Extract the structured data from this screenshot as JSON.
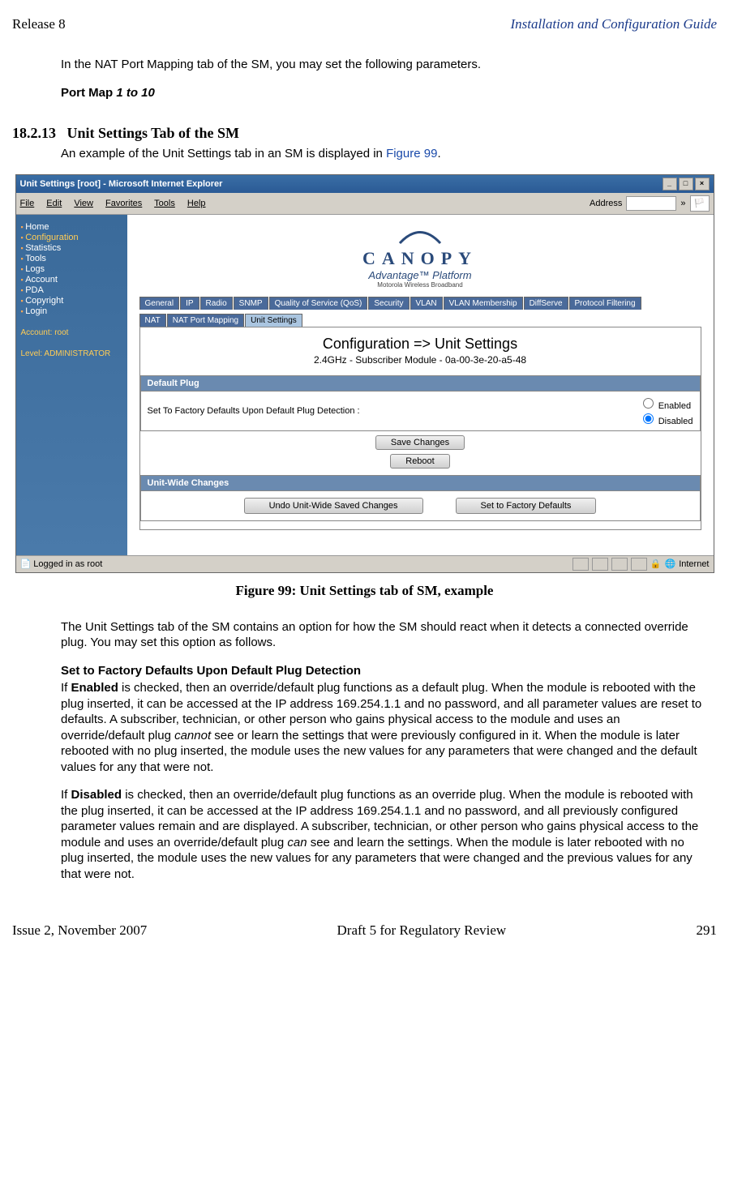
{
  "header": {
    "left": "Release 8",
    "right": "Installation and Configuration Guide"
  },
  "intro": {
    "p1": "In the NAT Port Mapping tab of the SM, you may set the following parameters.",
    "portmap_label": "Port Map ",
    "portmap_range": "1 to 10"
  },
  "section": {
    "number": "18.2.13",
    "title": "Unit Settings Tab of the SM",
    "lead": "An example of the Unit Settings tab in an SM is displayed in ",
    "figref": "Figure 99",
    "period": "."
  },
  "screenshot": {
    "window_title": "Unit Settings [root] - Microsoft Internet Explorer",
    "menubar": [
      "File",
      "Edit",
      "View",
      "Favorites",
      "Tools",
      "Help"
    ],
    "address_label": "Address",
    "sidebar": {
      "items": [
        "Home",
        "Configuration",
        "Statistics",
        "Tools",
        "Logs",
        "Account",
        "PDA",
        "Copyright",
        "Login"
      ],
      "account": "Account: root",
      "level": "Level: ADMINISTRATOR"
    },
    "logo": {
      "name": "CANOPY",
      "sub": "Advantage™ Platform",
      "tag": "Motorola Wireless Broadband"
    },
    "tabs_row1": [
      "General",
      "IP",
      "Radio",
      "SNMP",
      "Quality of Service (QoS)",
      "Security",
      "VLAN",
      "VLAN Membership",
      "DiffServe",
      "Protocol Filtering"
    ],
    "tabs_row2": [
      "NAT",
      "NAT Port Mapping",
      "Unit Settings"
    ],
    "conf_title": "Configuration => Unit Settings",
    "conf_sub": "2.4GHz - Subscriber Module - 0a-00-3e-20-a5-48",
    "panel1_header": "Default Plug",
    "panel1_label": "Set To Factory Defaults Upon Default Plug Detection :",
    "radio_enabled": "Enabled",
    "radio_disabled": "Disabled",
    "btn_save": "Save Changes",
    "btn_reboot": "Reboot",
    "panel2_header": "Unit-Wide Changes",
    "btn_undo": "Undo Unit-Wide Saved Changes",
    "btn_factory": "Set to Factory Defaults",
    "status_left": "Logged in as root",
    "status_right": "Internet"
  },
  "caption": "Figure 99: Unit Settings tab of SM, example",
  "after": {
    "p1": "The Unit Settings tab of the SM contains an option for how the SM should react when it detects a connected override plug. You may set this option as follows.",
    "h1": "Set to Factory Defaults Upon Default Plug Detection",
    "p2a": "If ",
    "p2b": "Enabled",
    "p2c": " is checked, then an override/default plug functions as a default plug. When the module is rebooted with the plug inserted, it can be accessed at the IP address 169.254.1.1 and no password, and all parameter values are reset to defaults. A subscriber, technician, or other person who gains physical access to the module and uses an override/default plug ",
    "p2d": "cannot",
    "p2e": " see or learn the settings that were previously configured in it. When the module is later rebooted with no plug inserted, the module uses the new values for any parameters that were changed and the default values for any that were not.",
    "p3a": "If ",
    "p3b": "Disabled",
    "p3c": " is checked, then an override/default plug functions as an override plug. When the module is rebooted with the plug inserted, it can be accessed at the IP address 169.254.1.1 and no password, and all previously configured parameter values remain and are displayed. A subscriber, technician, or other person who gains physical access to the module and uses an override/default plug ",
    "p3d": "can",
    "p3e": " see and learn the settings. When the module is later rebooted with no plug inserted, the module uses the new values for any parameters that were changed and the previous values for any that were not."
  },
  "footer": {
    "left": "Issue 2, November 2007",
    "center": "Draft 5 for Regulatory Review",
    "right": "291"
  }
}
